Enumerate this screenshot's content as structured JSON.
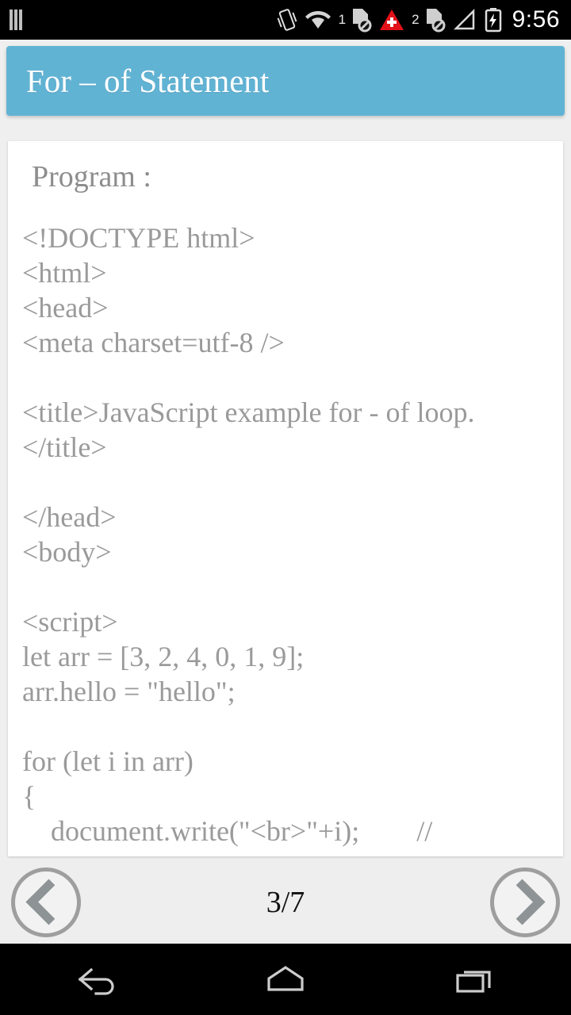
{
  "statusbar": {
    "left_icon": "vertical-bars-icon",
    "icons": [
      {
        "name": "vibrate-icon"
      },
      {
        "name": "wifi-icon"
      },
      {
        "name": "sim1-disabled-icon",
        "label": "1"
      },
      {
        "name": "emergency-alert-icon"
      },
      {
        "name": "sim2-disabled-icon",
        "label": "2"
      },
      {
        "name": "cellular-signal-icon"
      },
      {
        "name": "battery-charging-icon"
      }
    ],
    "time": "9:56"
  },
  "header": {
    "title": "For – of Statement",
    "bg_color": "#61b3d4",
    "text_color": "#ffffff"
  },
  "content": {
    "program_label": "Program :",
    "code": "<!DOCTYPE html>\n<html>\n<head>\n<meta charset=utf-8 />\n\n<title>JavaScript example for - of loop.</title>\n\n</head>\n<body>\n\n<script>\nlet arr = [3, 2, 4, 0, 1, 9];\narr.hello = \"hello\";\n\nfor (let i in arr)\n{\n    document.write(\"<br>\"+i);        //",
    "text_color": "#9a9a9a"
  },
  "pager": {
    "prev_label": "prev-page",
    "next_label": "next-page",
    "page_indicator": "3/7",
    "current_page": 3,
    "total_pages": 7
  },
  "navbar": {
    "back": "back-button",
    "home": "home-button",
    "recents": "recents-button"
  }
}
